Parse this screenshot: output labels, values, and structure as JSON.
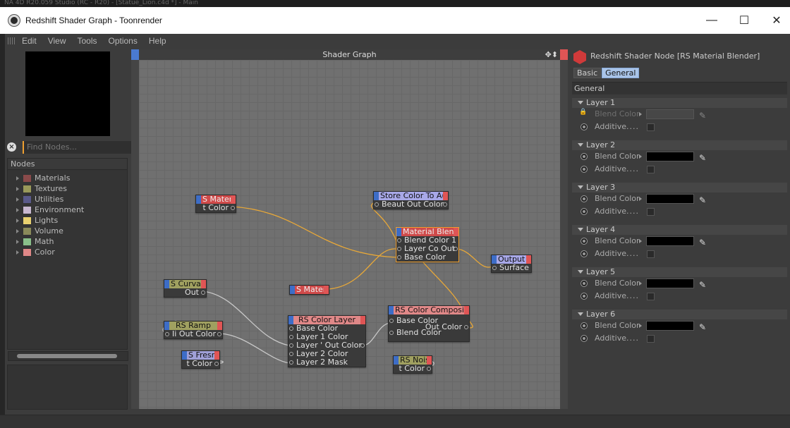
{
  "top_strip": "NA 4D R20.059 Studio (RC - R20) - [Statue_Lion.c4d *] - Main",
  "window": {
    "title": "Redshift Shader Graph - Toonrender",
    "controls": {
      "minimize": "—",
      "maximize": "☐",
      "close": "✕"
    }
  },
  "menu": [
    "Edit",
    "View",
    "Tools",
    "Options",
    "Help"
  ],
  "find": {
    "placeholder": "Find Nodes..."
  },
  "nodes_panel": {
    "header": "Nodes",
    "items": [
      {
        "label": "Materials",
        "color": "#8a4a4a"
      },
      {
        "label": "Textures",
        "color": "#9a9a5a"
      },
      {
        "label": "Utilities",
        "color": "#5a5a8a"
      },
      {
        "label": "Environment",
        "color": "#c8b8d0"
      },
      {
        "label": "Lights",
        "color": "#e8d070"
      },
      {
        "label": "Volume",
        "color": "#8a8a5a"
      },
      {
        "label": "Math",
        "color": "#8ac08a"
      },
      {
        "label": "Color",
        "color": "#e08888"
      }
    ]
  },
  "graph": {
    "title": "Shader Graph",
    "move_icon": "✥⬍",
    "nodes": {
      "material1": {
        "title": "S Materi",
        "out": "t Color",
        "header_color": "#d04a4a"
      },
      "store": {
        "title": "Store Color To A(",
        "in": "Beaut",
        "out": "Out Color",
        "header_color": "#a8a8e8"
      },
      "blend": {
        "title": "Material Blenc",
        "rows": [
          "Blend Color 1",
          "Layer Co Out",
          "Base Color"
        ],
        "header_color": "#d04a4a"
      },
      "output": {
        "title": "Output",
        "row": "Surface",
        "header_color": "#a8a8e8"
      },
      "curvature": {
        "title": "S Curvatu",
        "out": "Out",
        "header_color": "#a0a060"
      },
      "material2": {
        "title": "S Materi",
        "header_color": "#d04a4a"
      },
      "ramp": {
        "title": "RS Ramp",
        "in": "Ii",
        "out": "Out Color",
        "header_color": "#a0a060"
      },
      "fresnel": {
        "title": "S Fresne",
        "out": "t Color",
        "header_color": "#a0a0d8"
      },
      "colorlayer": {
        "title": "RS Color Layer",
        "rows": [
          "Base Color",
          "Layer 1 Color",
          "Layer ' Out Color",
          "Layer 2 Color",
          "Layer 2 Mask"
        ],
        "header_color": "#e08888"
      },
      "composite": {
        "title": "RS Color Composite",
        "rows": [
          "Base Color",
          "Out Color",
          "Blend Color"
        ],
        "header_color": "#e08888"
      },
      "noise": {
        "title": "RS Noise",
        "out": "t Color",
        "header_color": "#a0a060"
      }
    }
  },
  "right_panel": {
    "title": "Redshift Shader Node [RS Material Blender]",
    "tabs": [
      {
        "label": "Basic",
        "active": false
      },
      {
        "label": "General",
        "active": true
      }
    ],
    "section": "General",
    "layers": [
      {
        "name": "Layer 1",
        "blend_label": "Blend Color",
        "additive_label": "Additive",
        "locked": true
      },
      {
        "name": "Layer 2",
        "blend_label": "Blend Color",
        "additive_label": "Additive",
        "locked": false
      },
      {
        "name": "Layer 3",
        "blend_label": "Blend Color",
        "additive_label": "Additive",
        "locked": false
      },
      {
        "name": "Layer 4",
        "blend_label": "Blend Color",
        "additive_label": "Additive",
        "locked": false
      },
      {
        "name": "Layer 5",
        "blend_label": "Blend Color",
        "additive_label": "Additive",
        "locked": false
      },
      {
        "name": "Layer 6",
        "blend_label": "Blend Color",
        "additive_label": "Additive",
        "locked": false
      }
    ],
    "dots": "....",
    "picker_icon": "eyedropper-icon"
  }
}
